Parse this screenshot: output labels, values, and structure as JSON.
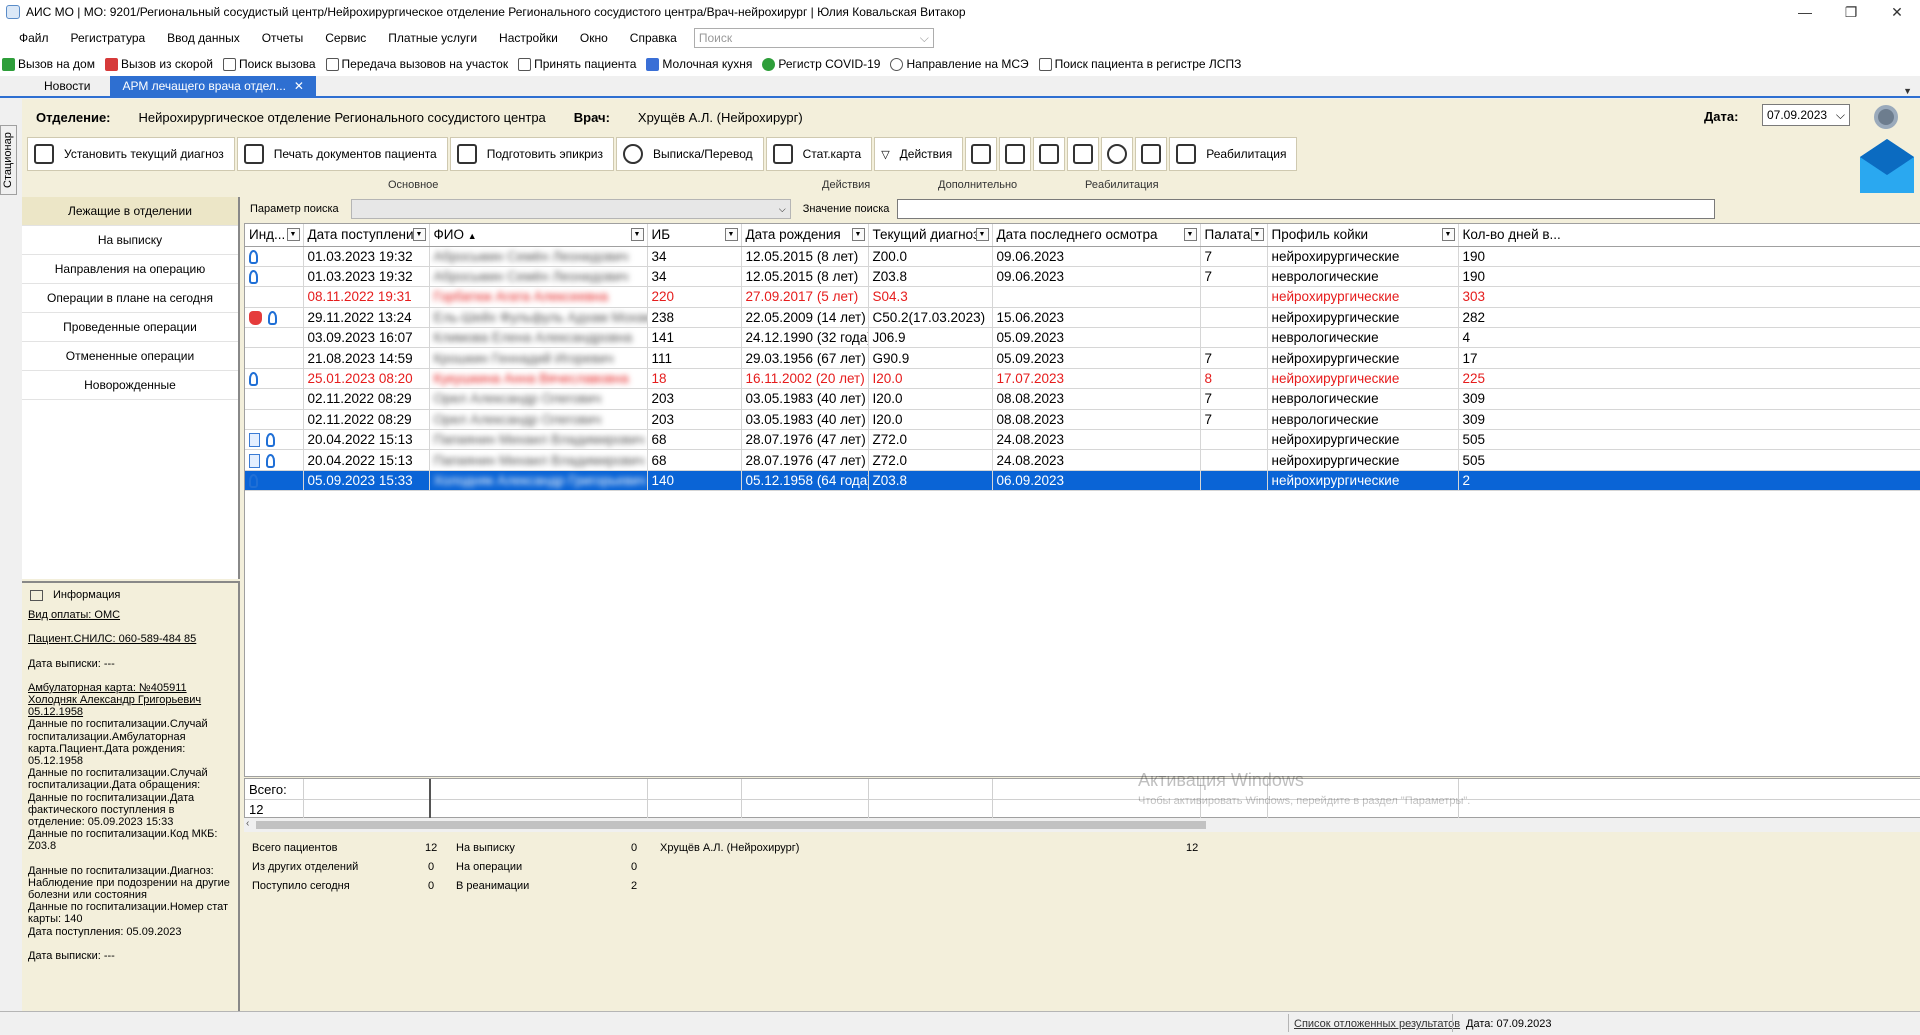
{
  "window": {
    "title": "АИС МО | МО: 9201/Региональный сосудистый центр/Нейрохирургическое отделение Регионального сосудистого центра/Врач-нейрохирург | Юлия Ковальская Витакор",
    "minimize": "—",
    "restore": "❐",
    "close": "✕"
  },
  "menu": {
    "items": [
      "Файл",
      "Регистратура",
      "Ввод данных",
      "Отчеты",
      "Сервис",
      "Платные услуги",
      "Настройки",
      "Окно",
      "Справка"
    ],
    "search_placeholder": "Поиск"
  },
  "quickbar": {
    "items": [
      {
        "label": "Вызов на дом",
        "icon": "home-call-icon",
        "color": "#2e9e3a"
      },
      {
        "label": "Вызов из скорой",
        "icon": "ambulance-call-icon",
        "color": "#d63a3a"
      },
      {
        "label": "Поиск вызова",
        "icon": "search-call-icon",
        "color": "#555555"
      },
      {
        "label": "Передача вызовов на участок",
        "icon": "transfer-icon",
        "color": "#555555"
      },
      {
        "label": "Принять пациента",
        "icon": "accept-patient-icon",
        "color": "#555555"
      },
      {
        "label": "Молочная кухня",
        "icon": "milk-icon",
        "color": "#3a6fd6"
      },
      {
        "label": "Регистр COVID-19",
        "icon": "covid-icon",
        "color": "#2e9e3a"
      },
      {
        "label": "Направление на МСЭ",
        "icon": "mse-icon",
        "color": "#555555"
      },
      {
        "label": "Поиск пациента в регистре ЛСПЗ",
        "icon": "registry-search-icon",
        "color": "#555555"
      }
    ]
  },
  "tabs": {
    "news": "Новости",
    "active": "АРМ лечащего врача отдел...",
    "close": "✕"
  },
  "side_tab": "Стационар",
  "header": {
    "dept_label": "Отделение:",
    "dept_value": "Нейрохирургическое отделение Регионального сосудистого центра",
    "doctor_label": "Врач:",
    "doctor_value": "Хрущёв А.Л. (Нейрохирург)",
    "date_label": "Дата:",
    "date_value": "07.09.2023"
  },
  "actions": {
    "set_diagnosis": "Установить текущий диагноз",
    "print_docs": "Печать документов пациента",
    "prepare_epicrisis": "Подготовить эпикриз",
    "discharge_transfer": "Выписка/Перевод",
    "stat_card": "Стат.карта",
    "actions_menu": "Действия",
    "rehab": "Реабилитация",
    "group_main": "Основное",
    "group_actions": "Действия",
    "group_additional": "Дополнительно",
    "group_rehab": "Реабилитация"
  },
  "leftnav": {
    "items": [
      "Лежащие в отделении",
      "На выписку",
      "Направления на операцию",
      "Операции в плане на сегодня",
      "Проведенные операции",
      "Отмененные операции",
      "Новорожденные"
    ]
  },
  "info": {
    "title": "Информация",
    "pay_type": "Вид оплаты: ОМС",
    "snils": "Пациент.СНИЛС: 060-589-484 85",
    "discharge1": "Дата выписки: ---",
    "amb_card": "Амбулаторная карта: №405911 Холодняк Александр Григорьевич 05.12.1958",
    "hosp_case": "Данные по госпитализации.Случай госпитализации.Амбулаторная карта.Пациент.Дата рождения: 05.12.1958",
    "hosp_date_app": "Данные по госпитализации.Случай госпитализации.Дата обращения:",
    "hosp_fact_date": "Данные по госпитализации.Дата фактического поступления в отделение: 05.09.2023 15:33",
    "hosp_mkb": "Данные по госпитализации.Код МКБ: Z03.8",
    "hosp_diag": "Данные по госпитализации.Диагноз: Наблюдение при подозрении на другие болезни или состояния",
    "hosp_stat_num": "Данные по госпитализации.Номер стат карты: 140",
    "admission_date": "Дата поступления: 05.09.2023",
    "discharge2": "Дата выписки: ---"
  },
  "filter": {
    "param_label": "Параметр поиска",
    "value_label": "Значение поиска"
  },
  "grid": {
    "columns": [
      "Инд...",
      "Дата поступления",
      "ФИО",
      "ИБ",
      "Дата рождения",
      "Текущий диагноз",
      "Дата последнего осмотра",
      "Палата",
      "Профиль койки",
      "Кол-во дней в..."
    ],
    "rows": [
      {
        "icons": [
          "ribbon"
        ],
        "admit": "01.03.2023 19:32",
        "fio": "Абросьмин Семён Леонидович",
        "ib": "34",
        "birth": "12.05.2015 (8 лет)",
        "diag": "Z00.0",
        "last": "09.06.2023",
        "ward": "7",
        "profile": "нейрохирургические",
        "days": "190",
        "style": ""
      },
      {
        "icons": [
          "ribbon"
        ],
        "admit": "01.03.2023 19:32",
        "fio": "Абросьмин Семён Леонидович",
        "ib": "34",
        "birth": "12.05.2015 (8 лет)",
        "diag": "Z03.8",
        "last": "09.06.2023",
        "ward": "7",
        "profile": "неврологические",
        "days": "190",
        "style": ""
      },
      {
        "icons": [],
        "admit": "08.11.2022 19:31",
        "fio": "Горбатюк Агата Алексеевна",
        "ib": "220",
        "birth": "27.09.2017 (5 лет)",
        "diag": "S04.3",
        "last": "",
        "ward": "",
        "profile": "нейрохирургические",
        "days": "303",
        "style": "red"
      },
      {
        "icons": [
          "hand",
          "ribbon"
        ],
        "admit": "29.11.2022 13:24",
        "fio": "Ель-Шейх Фульфуль Адхам Мохаммед",
        "ib": "238",
        "birth": "22.05.2009 (14 лет)",
        "diag": "C50.2(17.03.2023)",
        "last": "15.06.2023",
        "ward": "",
        "profile": "нейрохирургические",
        "days": "282",
        "style": ""
      },
      {
        "icons": [],
        "admit": "03.09.2023 16:07",
        "fio": "Климова Елена Александровна",
        "ib": "141",
        "birth": "24.12.1990 (32 года)",
        "diag": "J06.9",
        "last": "05.09.2023",
        "ward": "",
        "profile": "неврологические",
        "days": "4",
        "style": ""
      },
      {
        "icons": [],
        "admit": "21.08.2023 14:59",
        "fio": "Крошкин Геннадий Игоревич",
        "ib": "111",
        "birth": "29.03.1956 (67 лет)",
        "diag": "G90.9",
        "last": "05.09.2023",
        "ward": "7",
        "profile": "нейрохирургические",
        "days": "17",
        "style": ""
      },
      {
        "icons": [
          "ribbon"
        ],
        "admit": "25.01.2023 08:20",
        "fio": "Кукушкина Анна Вячеславовна",
        "ib": "18",
        "birth": "16.11.2002 (20 лет)",
        "diag": "I20.0",
        "last": "17.07.2023",
        "ward": "8",
        "profile": "нейрохирургические",
        "days": "225",
        "style": "red"
      },
      {
        "icons": [],
        "admit": "02.11.2022 08:29",
        "fio": "Орел Александр Олегович",
        "ib": "203",
        "birth": "03.05.1983 (40 лет)",
        "diag": "I20.0",
        "last": "08.08.2023",
        "ward": "7",
        "profile": "неврологические",
        "days": "309",
        "style": ""
      },
      {
        "icons": [],
        "admit": "02.11.2022 08:29",
        "fio": "Орел Александр Олегович",
        "ib": "203",
        "birth": "03.05.1983 (40 лет)",
        "diag": "I20.0",
        "last": "08.08.2023",
        "ward": "7",
        "profile": "неврологические",
        "days": "309",
        "style": ""
      },
      {
        "icons": [
          "doc",
          "ribbon"
        ],
        "admit": "20.04.2022 15:13",
        "fio": "Папаянин Михаил Владимирович",
        "ib": "68",
        "birth": "28.07.1976 (47 лет)",
        "diag": "Z72.0",
        "last": "24.08.2023",
        "ward": "",
        "profile": "нейрохирургические",
        "days": "505",
        "style": ""
      },
      {
        "icons": [
          "doc",
          "ribbon"
        ],
        "admit": "20.04.2022 15:13",
        "fio": "Папаянин Михаил Владимирович",
        "ib": "68",
        "birth": "28.07.1976 (47 лет)",
        "diag": "Z72.0",
        "last": "24.08.2023",
        "ward": "",
        "profile": "нейрохирургические",
        "days": "505",
        "style": ""
      },
      {
        "icons": [
          "ribbon"
        ],
        "admit": "05.09.2023 15:33",
        "fio": "Холодняк Александр Григорьевич",
        "ib": "140",
        "birth": "05.12.1958 (64 года)",
        "diag": "Z03.8",
        "last": "06.09.2023",
        "ward": "",
        "profile": "нейрохирургические",
        "days": "2",
        "style": "sel"
      }
    ],
    "totals_label": "Всего:",
    "totals_value": "12"
  },
  "stats": {
    "total_patients_label": "Всего пациентов",
    "total_patients": "12",
    "from_other_label": "Из других отделений",
    "from_other": "0",
    "admitted_today_label": "Поступило сегодня",
    "admitted_today": "0",
    "to_discharge_label": "На выписку",
    "to_discharge": "0",
    "on_surgery_label": "На операции",
    "on_surgery": "0",
    "icu_label": "В реанимации",
    "icu": "2",
    "doctor": "Хрущёв А.Л. (Нейрохирург)",
    "doctor_count": "12"
  },
  "watermark": {
    "line1": "Активация Windows",
    "line2": "Чтобы активировать Windows, перейдите в раздел \"Параметры\"."
  },
  "statusbar": {
    "deferred": "Список отложенных результатов",
    "date": "Дата: 07.09.2023"
  }
}
